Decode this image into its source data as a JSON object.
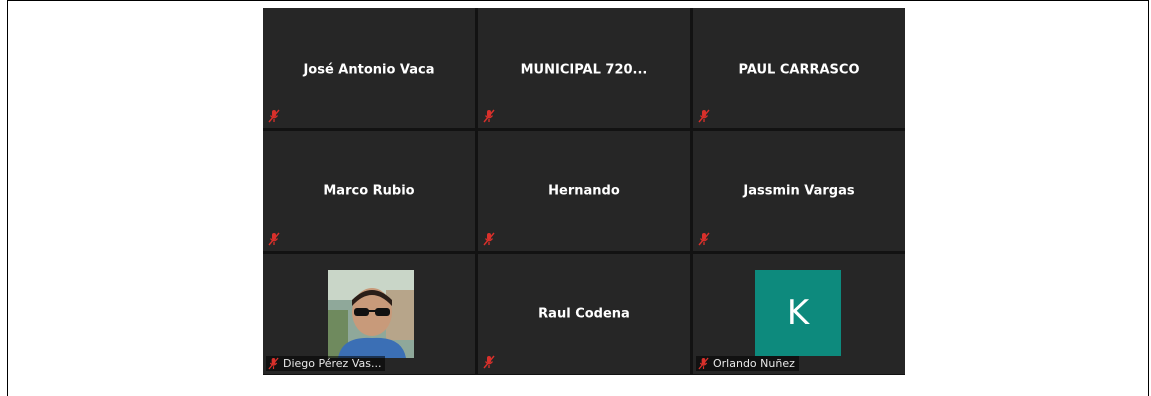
{
  "participants": [
    {
      "name": "José Antonio Vaca",
      "muted": true
    },
    {
      "name": "MUNICIPAL 720...",
      "muted": true
    },
    {
      "name": "PAUL CARRASCO",
      "muted": true
    },
    {
      "name": "Marco Rubio",
      "muted": true
    },
    {
      "name": "Hernando",
      "muted": true
    },
    {
      "name": "Jassmin Vargas",
      "muted": true
    },
    {
      "name": "Diego Pérez Vas...",
      "muted": true,
      "video": "photo"
    },
    {
      "name": "Raul Codena",
      "muted": true
    },
    {
      "name": "Orlando Nuñez",
      "muted": true,
      "avatar_letter": "K",
      "avatar_color": "#0d8a7d"
    }
  ],
  "icons": {
    "mute": "muted-microphone-icon"
  },
  "colors": {
    "tile_bg": "#262626",
    "grid_bg": "#121212",
    "mute_red": "#d9302b"
  }
}
